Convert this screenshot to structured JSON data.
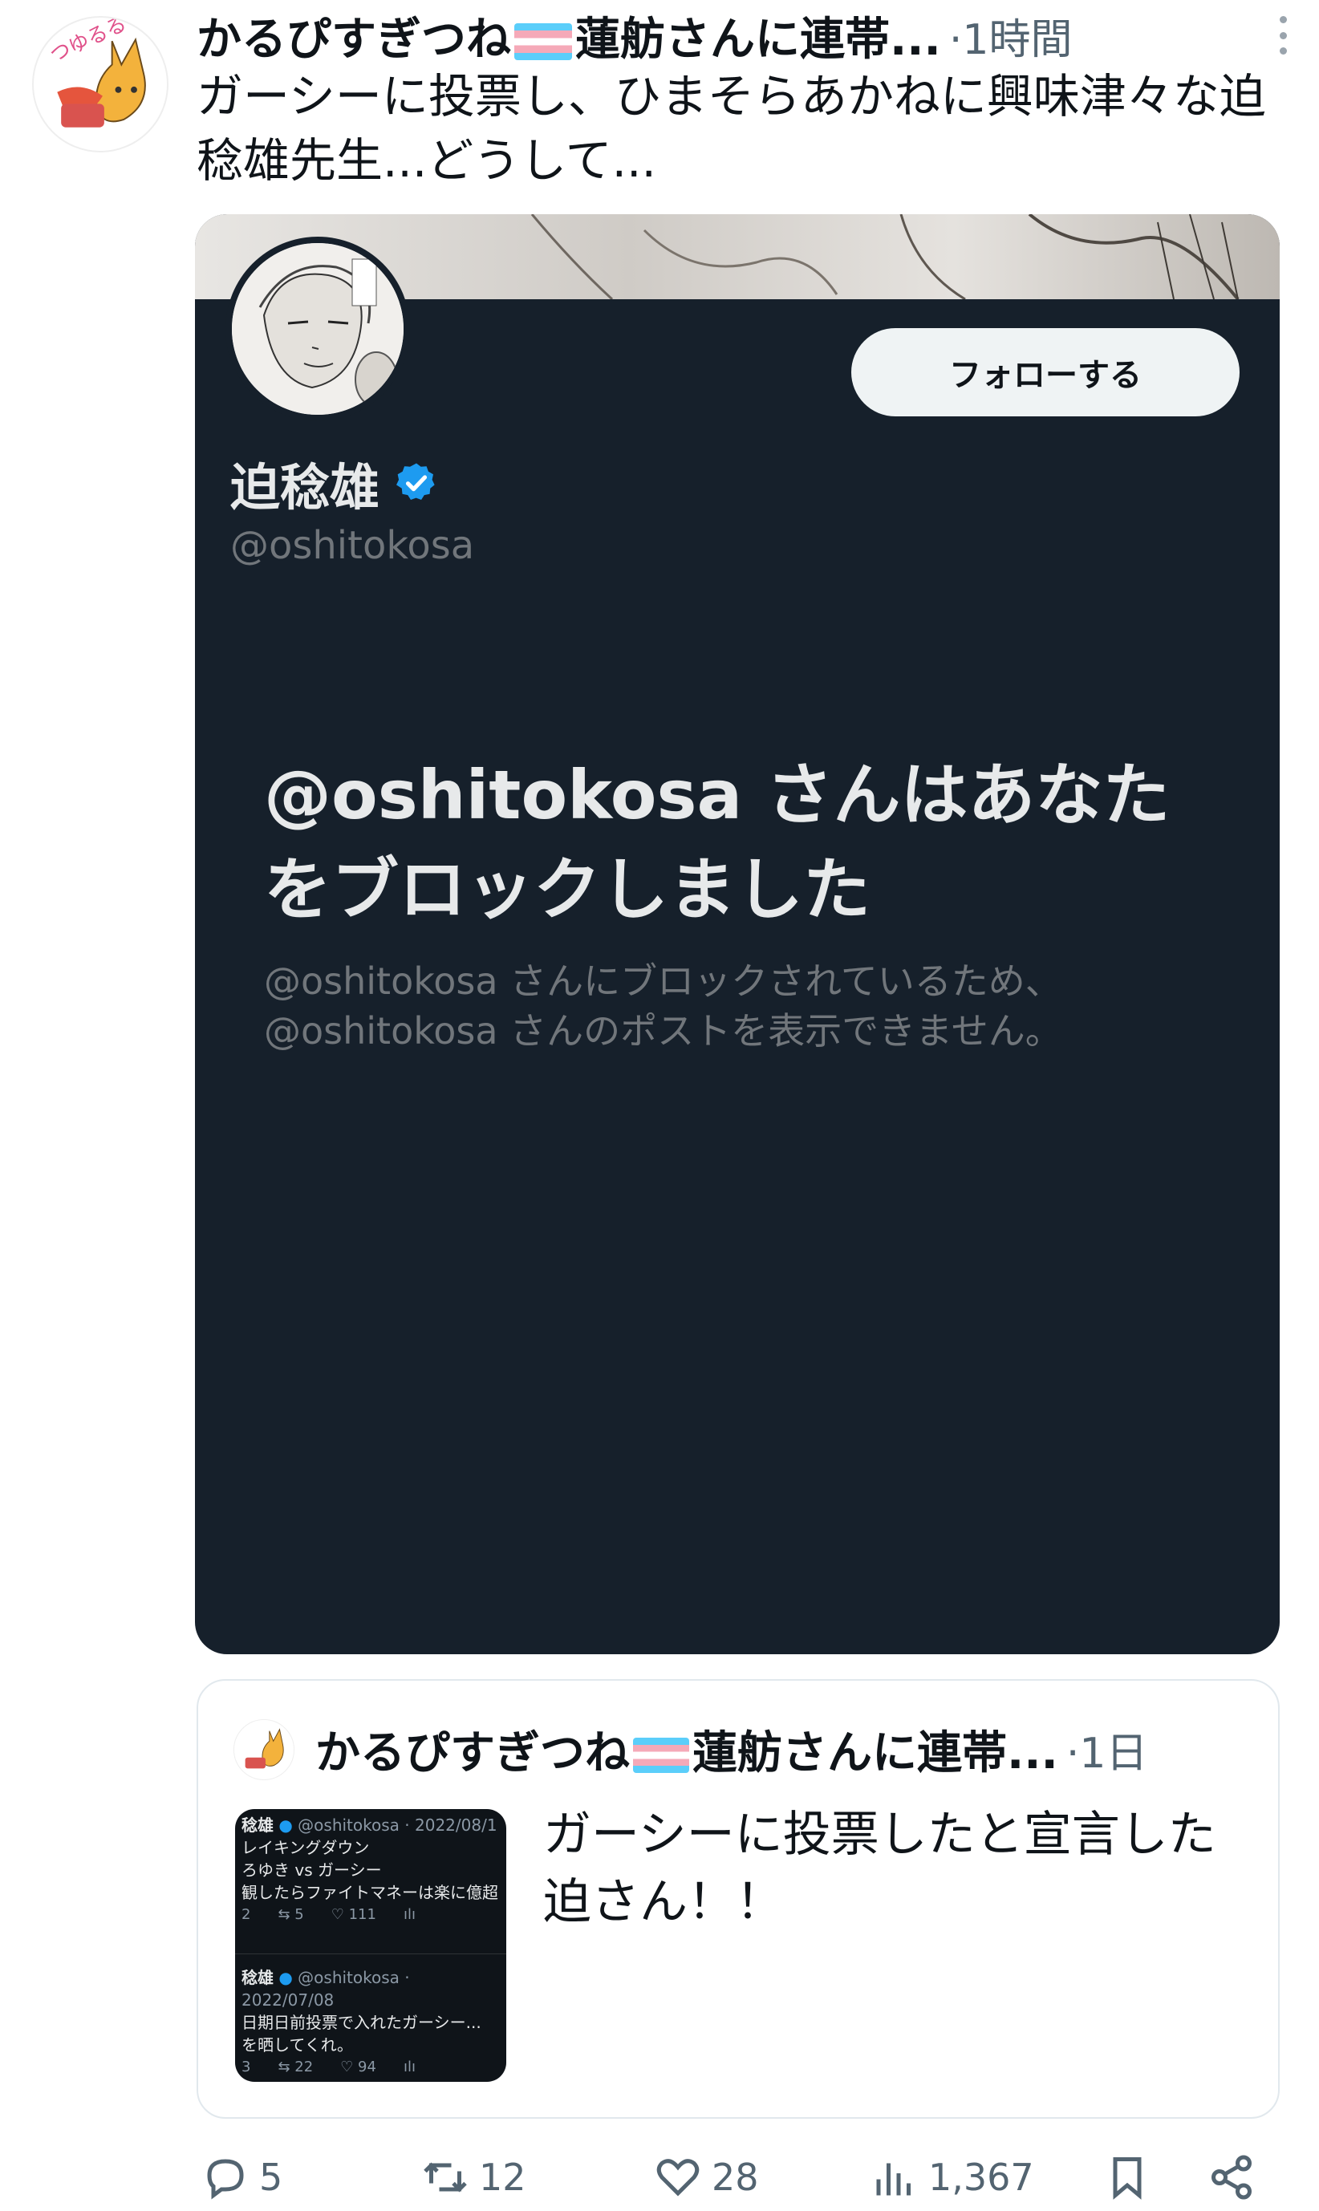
{
  "post": {
    "author_name": "かるぴすぎつね🏳️‍⚧️蓮舫さんに連帯...",
    "author_name_before_flag": "かるぴすぎつね",
    "author_name_after_flag": "蓮舫さんに連帯...",
    "separator": "·",
    "time": "1時間",
    "text": "ガーシーに投票し、ひまそらあかねに興味津々な迫稔雄先生...どうして...",
    "avatar_icon": "fox-character-avatar"
  },
  "card": {
    "follow_label": "フォローする",
    "display_name": "迫稔雄",
    "handle": "@oshitokosa",
    "blocked_title": "@oshitokosa さんはあなたをブロックしました",
    "blocked_desc_line1": "@oshitokosa さんにブロックされているため、",
    "blocked_desc_line2": "@oshitokosa さんのポストを表示できません。",
    "background_color": "#16202b",
    "verified_color": "#1d9bf0"
  },
  "quote": {
    "author_name_before_flag": "かるぴすぎつね",
    "author_name_after_flag": "蓮舫さんに連帯...",
    "separator": "·",
    "time": "1日",
    "text": "ガーシーに投票したと宣言した迫さん！！",
    "thumbnail": {
      "tweet1": {
        "name": "稔雄",
        "meta": "@oshitokosa · 2022/08/1",
        "line1": "レイキングダウン",
        "line2": "ろゆき vs ガーシー",
        "line3": "観したらファイトマネーは楽に億超",
        "reply": "2",
        "retweet": "5",
        "like": "111"
      },
      "tweet2": {
        "name": "稔雄",
        "meta": "@oshitokosa · 2022/07/08",
        "line1": "日期日前投票で入れたガーシー...",
        "line2": "を晒してくれ。",
        "reply": "3",
        "retweet": "22",
        "like": "94"
      }
    }
  },
  "actions": {
    "reply_count": "5",
    "retweet_count": "12",
    "like_count": "28",
    "views_count": "1,367"
  }
}
